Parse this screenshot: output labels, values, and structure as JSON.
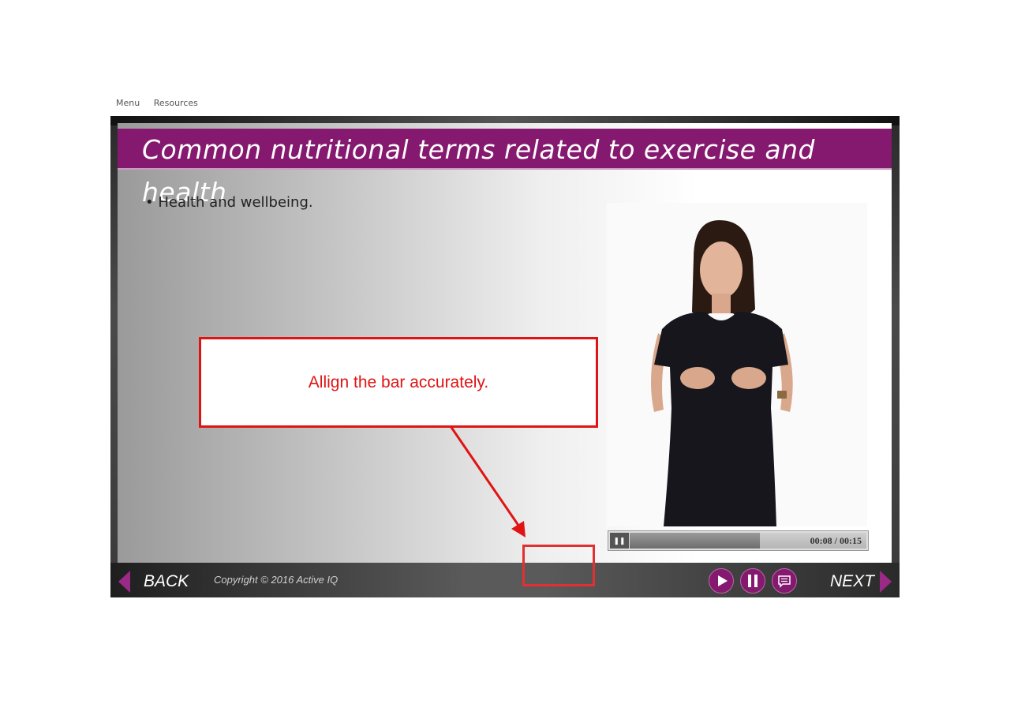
{
  "topnav": {
    "menu": "Menu",
    "resources": "Resources"
  },
  "slide": {
    "title": "Common nutritional terms related to exercise and health",
    "bullet": "• Health and wellbeing."
  },
  "video": {
    "time": "00:08 / 00:15",
    "progress": 0.55
  },
  "callout": {
    "text": "Allign the bar accurately."
  },
  "footer": {
    "back": "BACK",
    "copyright": "Copyright © 2016 Active IQ",
    "next": "NEXT"
  },
  "colors": {
    "brand": "#85196f",
    "annotation": "#e01414"
  },
  "icons": {
    "play": "play-icon",
    "pause": "pause-icon",
    "transcript": "transcript-icon"
  }
}
